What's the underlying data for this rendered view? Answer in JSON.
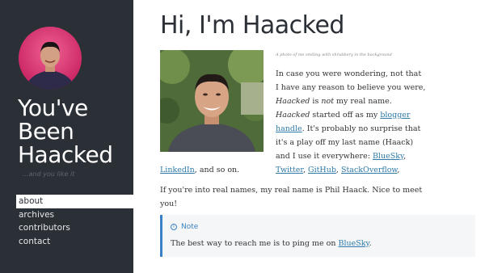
{
  "sidebar": {
    "site_title": "You've Been Haacked",
    "tagline": "...and you like it",
    "nav": [
      {
        "label": "about",
        "active": true
      },
      {
        "label": "archives",
        "active": false
      },
      {
        "label": "contributors",
        "active": false
      },
      {
        "label": "contact",
        "active": false
      }
    ]
  },
  "main": {
    "title": "Hi, I'm Haacked",
    "photo_caption": "A photo of me smiling with shrubbery in the background",
    "intro": {
      "l1": "In case you were wondering, not that",
      "l2": "I have any reason to believe you were,",
      "l3_name": "Haacked",
      "l3_is": " is ",
      "l3_not": "not",
      "l3_rest": " my real name.",
      "l4_name": "Haacked",
      "l4_rest": " started off as my ",
      "link_blogger": "blogger",
      "link_handle": "handle",
      "l5_rest": ". It's probably no surprise that",
      "l6": "it's a play off my last name (Haack)",
      "l7_pre": "and I use it everywhere: ",
      "link_bluesky": "BlueSky",
      "l7_comma": ",",
      "link_twitter": "Twitter",
      "link_github": "GitHub",
      "link_stackoverflow": "StackOverflow",
      "sep": ", ",
      "link_linkedin": "LinkedIn",
      "l9_rest": ", and so on."
    },
    "realname": {
      "l1": "If you're into real names, my real name is Phil Haack. Nice to meet",
      "l2": "you!"
    },
    "note": {
      "icon": "info-icon",
      "label": "Note",
      "body_pre": "The best way to reach me is to ping me on ",
      "body_link": "BlueSky",
      "body_post": "."
    }
  },
  "colors": {
    "sidebar_bg": "#2b2f36",
    "link": "#2e7aa8",
    "note_accent": "#3b82c4",
    "avatar_bg": "#e0407a"
  }
}
